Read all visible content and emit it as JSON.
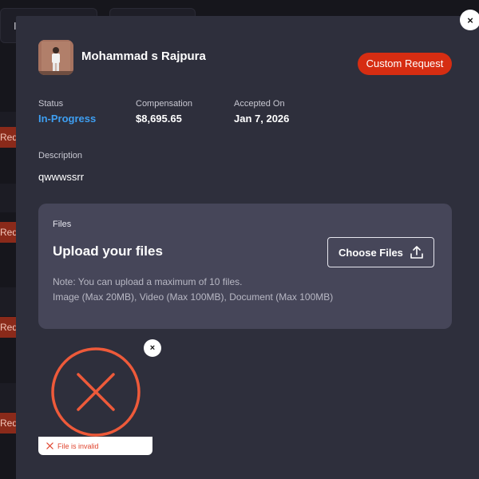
{
  "background": {
    "top_buttons": [
      "I",
      ""
    ],
    "row_tag": "Req"
  },
  "modal": {
    "close_icon": "×",
    "user": {
      "name": "Mohammad s Rajpura"
    },
    "custom_request_label": "Custom Request",
    "info": {
      "status": {
        "label": "Status",
        "value": "In-Progress"
      },
      "compensation": {
        "label": "Compensation",
        "value": "$8,695.65"
      },
      "accepted_on": {
        "label": "Accepted On",
        "value": "Jan 7, 2026"
      }
    },
    "description": {
      "label": "Description",
      "value": "qwwwssrr"
    },
    "files": {
      "label": "Files",
      "title": "Upload your files",
      "choose_button": "Choose Files",
      "note_line1": "Note: You can upload a maximum of 10 files.",
      "note_line2": "Image (Max 20MB), Video (Max 100MB), Document (Max 100MB)"
    },
    "invalid_file": {
      "remove_icon": "×",
      "message": "File is invalid"
    }
  },
  "colors": {
    "accent_red": "#d62d12",
    "status_blue": "#3e9ff2",
    "invalid_orange": "#ee5a3a",
    "modal_bg": "#2e2f3c",
    "files_bg": "#464659"
  }
}
